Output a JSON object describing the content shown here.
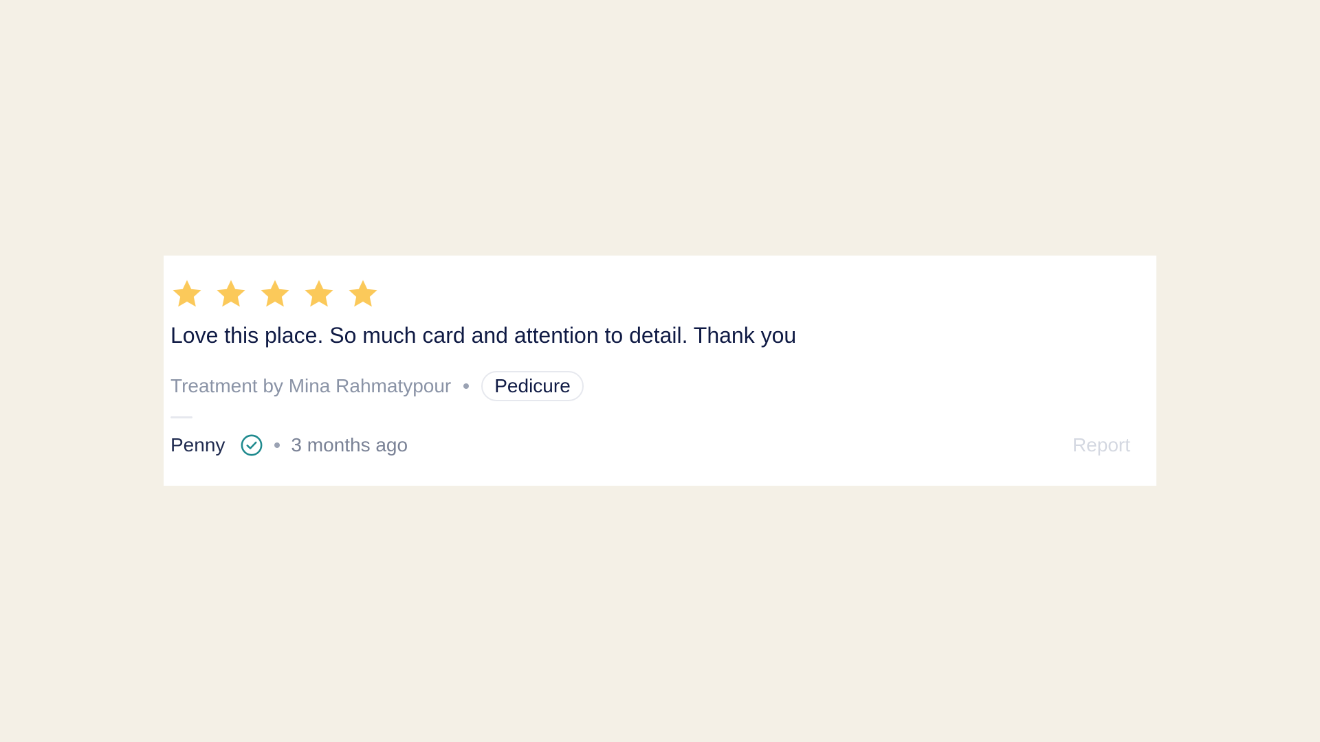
{
  "review": {
    "rating": 5,
    "rating_max": 5,
    "text": "Love this place. So much card and attention to detail. Thank you",
    "treatment_label": "Treatment by Mina Rahmatypour",
    "service": "Pedicure",
    "author": "Penny",
    "timestamp": "3 months ago",
    "report_label": "Report"
  },
  "icons": {
    "star": "star-icon",
    "verified": "verified-check-icon"
  },
  "colors": {
    "background": "#f4f0e6",
    "card": "#ffffff",
    "star": "#fbc95a",
    "text_primary": "#0f1a44",
    "text_muted": "#8a93a6",
    "verified": "#1f8a8e",
    "report": "#d4d8e1"
  }
}
